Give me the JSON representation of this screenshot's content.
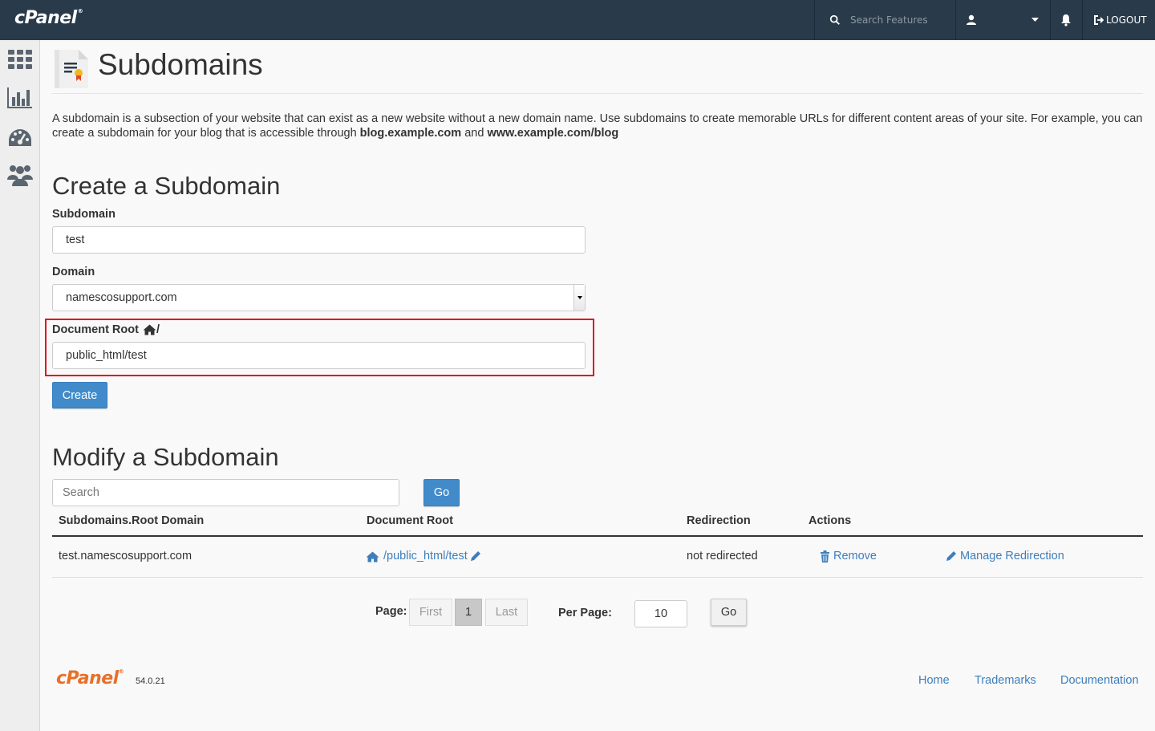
{
  "app": {
    "brand": "cPanel",
    "trademark": "®"
  },
  "topbar": {
    "search_placeholder": "Search Features",
    "logout_label": "LOGOUT"
  },
  "sidebar": {
    "items": [
      "home-grid",
      "statistics",
      "dashboard",
      "user-manager"
    ]
  },
  "page": {
    "title": "Subdomains",
    "description_1": "A subdomain is a subsection of your website that can exist as a new website without a new domain name. Use subdomains to create memorable URLs for different content areas of your site. For example, you can create a subdomain for your blog that is accessible through ",
    "description_bold_1": "blog.example.com",
    "description_2": " and ",
    "description_bold_2": "www.example.com/blog"
  },
  "create": {
    "heading": "Create a Subdomain",
    "subdomain_label": "Subdomain",
    "subdomain_value": "test",
    "domain_label": "Domain",
    "domain_value": "namescosupport.com",
    "docroot_label": "Document Root",
    "docroot_suffix": "/",
    "docroot_value": "public_html/test",
    "create_button": "Create"
  },
  "modify": {
    "heading": "Modify a Subdomain",
    "search_placeholder": "Search",
    "go_button": "Go",
    "columns": [
      "Subdomains.Root Domain",
      "Document Root",
      "Redirection",
      "Actions"
    ],
    "rows": [
      {
        "subdomain": "test.namescosupport.com",
        "docroot": "/public_html/test",
        "redirection": "not redirected",
        "remove": "Remove",
        "manage": "Manage Redirection"
      }
    ]
  },
  "pagination": {
    "page_label": "Page:",
    "first": "First",
    "current": "1",
    "last": "Last",
    "per_page_label": "Per Page:",
    "per_page_value": "10",
    "go": "Go"
  },
  "footer": {
    "version": "54.0.21",
    "links": [
      "Home",
      "Trademarks",
      "Documentation"
    ]
  },
  "colors": {
    "topbar": "#293a4a",
    "primary": "#428bca",
    "link": "#3e7ebc",
    "highlight": "#e0161b",
    "footer_logo": "#e8702a"
  }
}
